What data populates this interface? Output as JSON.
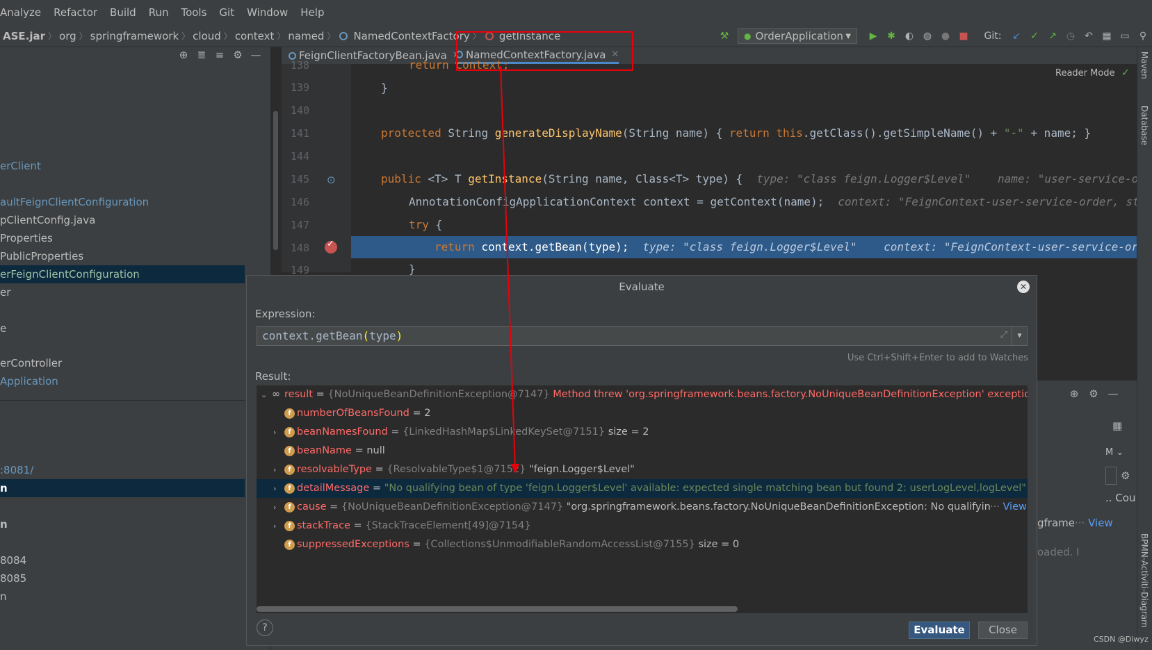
{
  "menu": [
    "Analyze",
    "Refactor",
    "Build",
    "Run",
    "Tools",
    "Git",
    "Window",
    "Help"
  ],
  "breadcrumb": {
    "jar": "ASE.jar",
    "path": [
      "org",
      "springframework",
      "cloud",
      "context",
      "named"
    ],
    "class_name": "NamedContextFactory",
    "method_name": "getInstance"
  },
  "run_config": "OrderApplication",
  "git_label": "Git:",
  "project_tree": [
    "erClient",
    "aultFeignClientConfiguration",
    "pClientConfig.java",
    "Properties",
    "PublicProperties",
    "erFeignClientConfiguration",
    "er",
    "e",
    "erController",
    "Application",
    ":8081/",
    "n",
    "n",
    "8084",
    "8085",
    "n"
  ],
  "editor_tabs": [
    {
      "label": "FeignClientFactoryBean.java"
    },
    {
      "label": "NamedContextFactory.java"
    }
  ],
  "reader_mode": "Reader Mode",
  "code": {
    "line_numbers": [
      "138",
      "139",
      "140",
      "141",
      "144",
      "145",
      "146",
      "147",
      "148",
      "149"
    ],
    "l138": "return context;",
    "l139": "}",
    "l141_a": "protected ",
    "l141_b": "String ",
    "l141_c": "generateDisplayName",
    "l141_d": "(String name) { ",
    "l141_e": "return this",
    "l141_f": ".getClass().getSimpleName() + ",
    "l141_g": "\"-\"",
    "l141_h": " + name; }",
    "l145_a": "public ",
    "l145_b": "<T> T ",
    "l145_c": "getInstance",
    "l145_d": "(String name, Class<T> type) {",
    "l145_hint": "type: \"class feign.Logger$Level\"    name: \"user-service-order\"",
    "l146_a": "AnnotationConfigApplicationContext context = getContext(name);",
    "l146_hint": "context: \"FeignContext-user-service-order, started o",
    "l147_a": "try",
    "l147_b": " {",
    "l148_a": "return",
    "l148_b": " context.getBean(type);",
    "l148_hint": "type: \"class feign.Logger$Level\"    context: \"FeignContext-user-service-order, sta",
    "l149": "}"
  },
  "right_strip": {
    "maven": "Maven",
    "database": "Database",
    "bpmn": "BPMN-Activiti-Diagram"
  },
  "debug_peek": {
    "cou": ".. Cou",
    "gframe": "gframe",
    "dots": "···",
    "view": "View",
    "loaded": "oaded. I",
    "m": "M"
  },
  "dialog": {
    "title": "Evaluate",
    "expression_label": "Expression:",
    "expression_a": "context.getBean",
    "expression_p1": "(",
    "expression_b": "type",
    "expression_p2": ")",
    "watch_hint": "Use Ctrl+Shift+Enter to add to Watches",
    "result_label": "Result:",
    "evaluate_label": "Evaluate",
    "close_label": "Close",
    "help_label": "?",
    "rows": {
      "r0_name": "result",
      "r0_ref": "{NoUniqueBeanDefinitionException@7147}",
      "r0_val": "Method threw 'org.springframework.beans.factory.NoUniqueBeanDefinitionException' exception.",
      "r1_name": "numberOfBeansFound",
      "r1_val": "2",
      "r2_name": "beanNamesFound",
      "r2_ref": "{LinkedHashMap$LinkedKeySet@7151}",
      "r2_val": "size = 2",
      "r3_name": "beanName",
      "r3_val": "null",
      "r4_name": "resolvableType",
      "r4_ref": "{ResolvableType$1@7152}",
      "r4_val": "\"feign.Logger$Level\"",
      "r5_name": "detailMessage",
      "r5_val": "\"No qualifying bean of type 'feign.Logger$Level' available: expected single matching bean but found 2: userLogLevel,logLevel\"",
      "r6_name": "cause",
      "r6_ref": "{NoUniqueBeanDefinitionException@7147}",
      "r6_val": "\"org.springframework.beans.factory.NoUniqueBeanDefinitionException: No qualifying bean o",
      "r6_more": "···",
      "r6_link": "View",
      "r7_name": "stackTrace",
      "r7_ref": "{StackTraceElement[49]@7154}",
      "r8_name": "suppressedExceptions",
      "r8_ref": "{Collections$UnmodifiableRandomAccessList@7155}",
      "r8_val": "size = 0"
    }
  },
  "watermark": "CSDN @Diwyz",
  "colors": {
    "annotation": "#e8000b",
    "accent": "#365880",
    "selection": "#0d293e",
    "current_line": "#2d5a88"
  }
}
